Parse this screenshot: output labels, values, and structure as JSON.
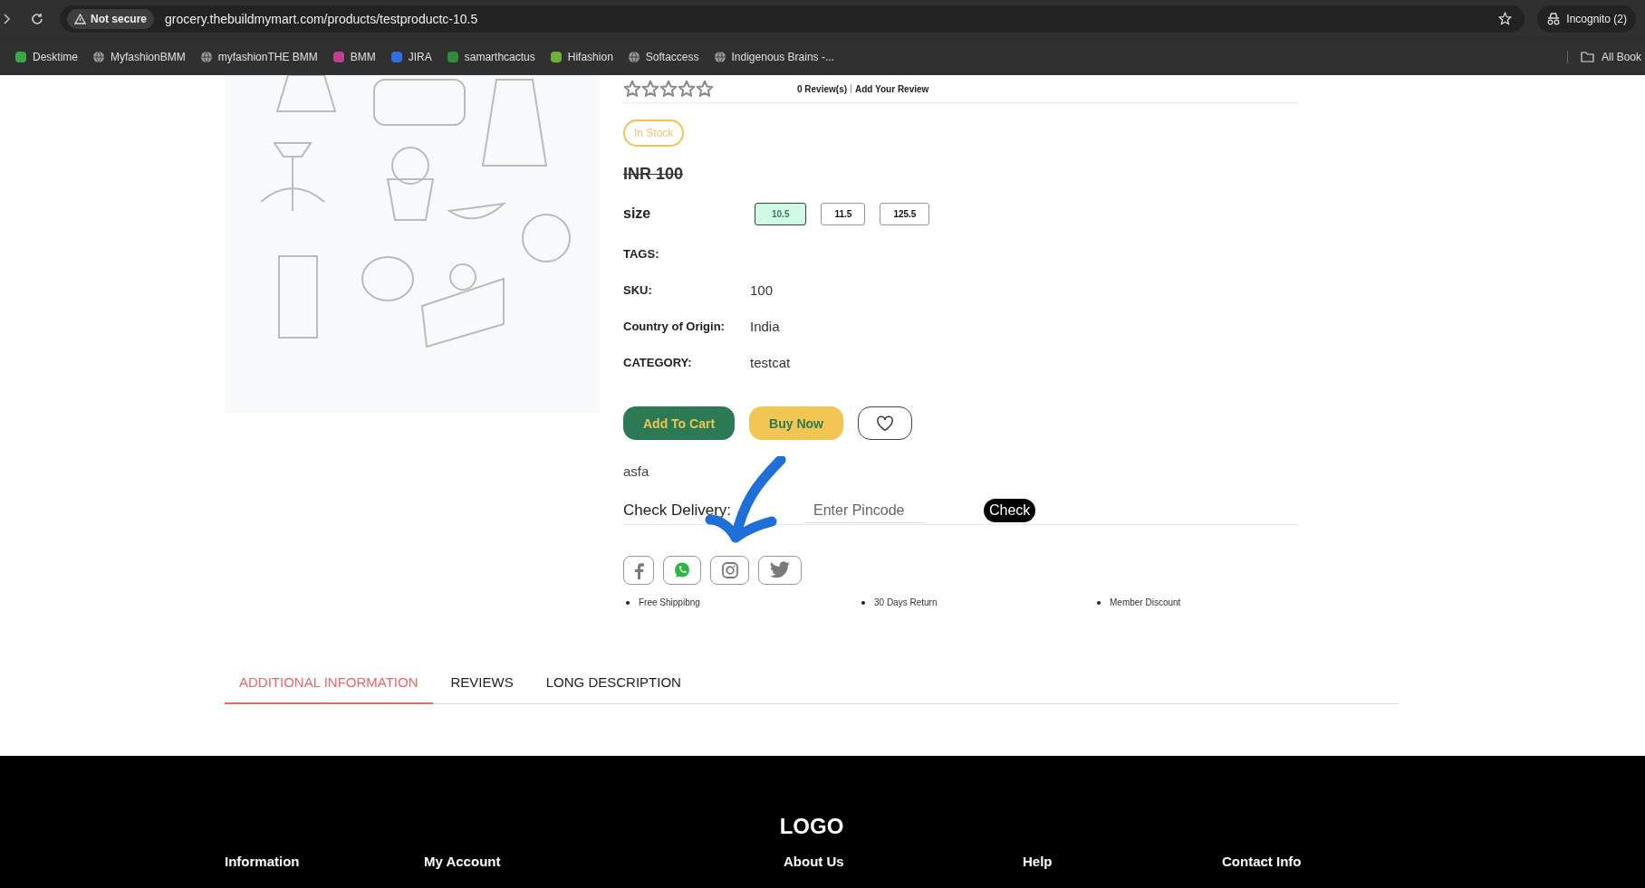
{
  "browser": {
    "security_label": "Not secure",
    "url": "grocery.thebuildmymart.com/products/testproductc-10.5",
    "profile_label": "Incognito (2)",
    "bookmarks": [
      {
        "label": "Desktime",
        "kind": "favicon",
        "color": "#3aa845"
      },
      {
        "label": "MyfashionBMM",
        "kind": "globe"
      },
      {
        "label": "myfashionTHE BMM",
        "kind": "globe"
      },
      {
        "label": "BMM",
        "kind": "favicon",
        "color": "#c0408f"
      },
      {
        "label": "JIRA",
        "kind": "favicon",
        "color": "#2f6fe0"
      },
      {
        "label": "samarthcactus",
        "kind": "favicon",
        "color": "#2f8c3a"
      },
      {
        "label": "Hifashion",
        "kind": "favicon",
        "color": "#6fb03a"
      },
      {
        "label": "Softaccess",
        "kind": "globe"
      },
      {
        "label": "Indigenous Brains -...",
        "kind": "globe"
      }
    ],
    "all_bookmarks_label": "All Book"
  },
  "product": {
    "image": {
      "kind": "picture"
    },
    "stars": 0,
    "reviews_count": "0 Review(s)",
    "add_review": "Add Your Review",
    "stock": "In Stock",
    "price": "INR 100",
    "price_struck": true,
    "size_label": "size",
    "sizes": [
      {
        "label": "10.5",
        "selected": true
      },
      {
        "label": "11.5",
        "selected": false
      },
      {
        "label": "125.5",
        "selected": false
      }
    ],
    "details": [
      {
        "label": "TAGS:"
      },
      {
        "label": "SKU:",
        "value": "100"
      },
      {
        "label": "Country of Origin:",
        "value": "India"
      },
      {
        "label": "CATEGORY:",
        "value": "testcat"
      }
    ],
    "add_to_cart": "Add To Cart",
    "buy_now": "Buy Now",
    "description": "asfa",
    "delivery": {
      "label": "Check Delivery:",
      "placeholder": "Enter Pincode",
      "button": "Check"
    },
    "share": [
      {
        "kind": "facebook"
      },
      {
        "kind": "whatsapp"
      },
      {
        "kind": "instagram"
      },
      {
        "kind": "twitter"
      }
    ],
    "features": [
      "Free Shippibng",
      "30 Days Return",
      "Member Discount"
    ]
  },
  "tabs": [
    {
      "label": "ADDITIONAL INFORMATION",
      "selected": true
    },
    {
      "label": "REVIEWS",
      "selected": false
    },
    {
      "label": "LONG DESCRIPTION",
      "selected": false
    }
  ],
  "footer": {
    "logo": "LOGO",
    "columns": [
      "Information",
      "My Account",
      "About Us",
      "Help",
      "Contact Info"
    ]
  }
}
